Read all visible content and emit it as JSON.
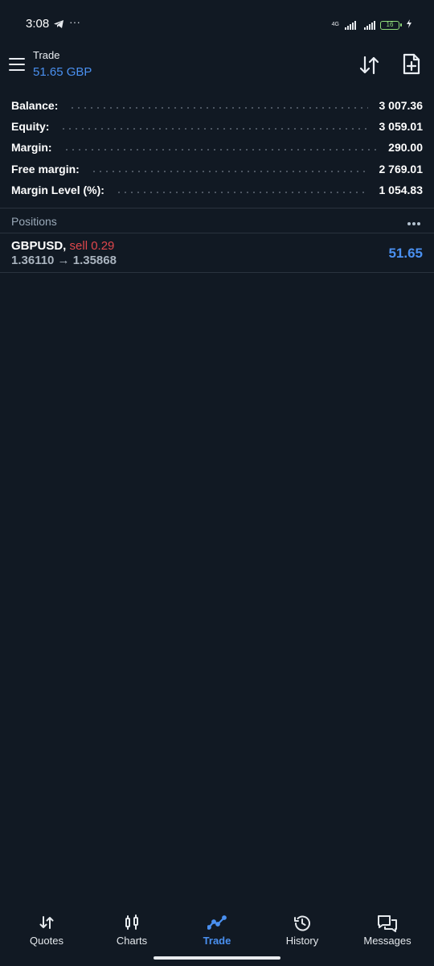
{
  "status_bar": {
    "time": "3:08",
    "extra": "···",
    "network": "4G",
    "battery": "16"
  },
  "header": {
    "title": "Trade",
    "subtitle": "51.65 GBP"
  },
  "summary": [
    {
      "label": "Balance:",
      "value": "3 007.36"
    },
    {
      "label": "Equity:",
      "value": "3 059.01"
    },
    {
      "label": "Margin:",
      "value": "290.00"
    },
    {
      "label": "Free margin:",
      "value": "2 769.01"
    },
    {
      "label": "Margin Level (%):",
      "value": "1 054.83"
    }
  ],
  "positions": {
    "title": "Positions",
    "items": [
      {
        "symbol": "GBPUSD,",
        "side": "sell 0.29",
        "prices": "1.36110 → 1.35868",
        "profit": "51.65"
      }
    ]
  },
  "nav": {
    "tabs": [
      {
        "label": "Quotes",
        "icon": "quotes-icon"
      },
      {
        "label": "Charts",
        "icon": "charts-icon"
      },
      {
        "label": "Trade",
        "icon": "trade-icon",
        "active": true
      },
      {
        "label": "History",
        "icon": "history-icon"
      },
      {
        "label": "Messages",
        "icon": "messages-icon"
      }
    ]
  },
  "colors": {
    "background": "#111923",
    "accent": "#4a90f0",
    "sell": "#e0474c"
  }
}
